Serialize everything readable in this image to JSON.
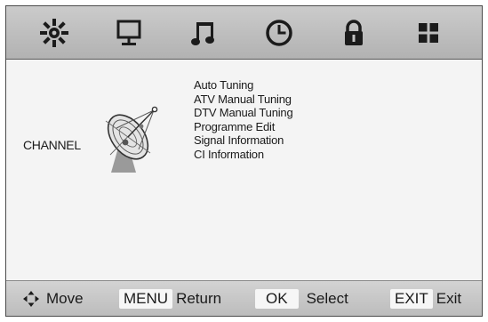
{
  "tabs": [
    {
      "icon": "picture-sun-icon",
      "active": true
    },
    {
      "icon": "monitor-icon",
      "active": false
    },
    {
      "icon": "music-note-icon",
      "active": false
    },
    {
      "icon": "clock-icon",
      "active": false
    },
    {
      "icon": "lock-icon",
      "active": false
    },
    {
      "icon": "grid-icon",
      "active": false
    }
  ],
  "section": {
    "label": "CHANNEL",
    "icon": "satellite-dish-icon"
  },
  "menu_items": [
    "Auto Tuning",
    "ATV Manual Tuning",
    "DTV Manual Tuning",
    "Programme Edit",
    "Signal Information",
    "CI Information"
  ],
  "hints": {
    "move": {
      "icon": "four-way-arrow-icon",
      "label": "Move"
    },
    "return": {
      "key": "MENU",
      "label": "Return"
    },
    "select": {
      "key": "OK",
      "label": "Select"
    },
    "exit": {
      "key": "EXIT",
      "label": "Exit"
    }
  },
  "colors": {
    "icon": "#1b1b1b",
    "topbar": "#c0c0c0",
    "content": "#f4f4f4",
    "bottombar": "#c6c6c6"
  }
}
